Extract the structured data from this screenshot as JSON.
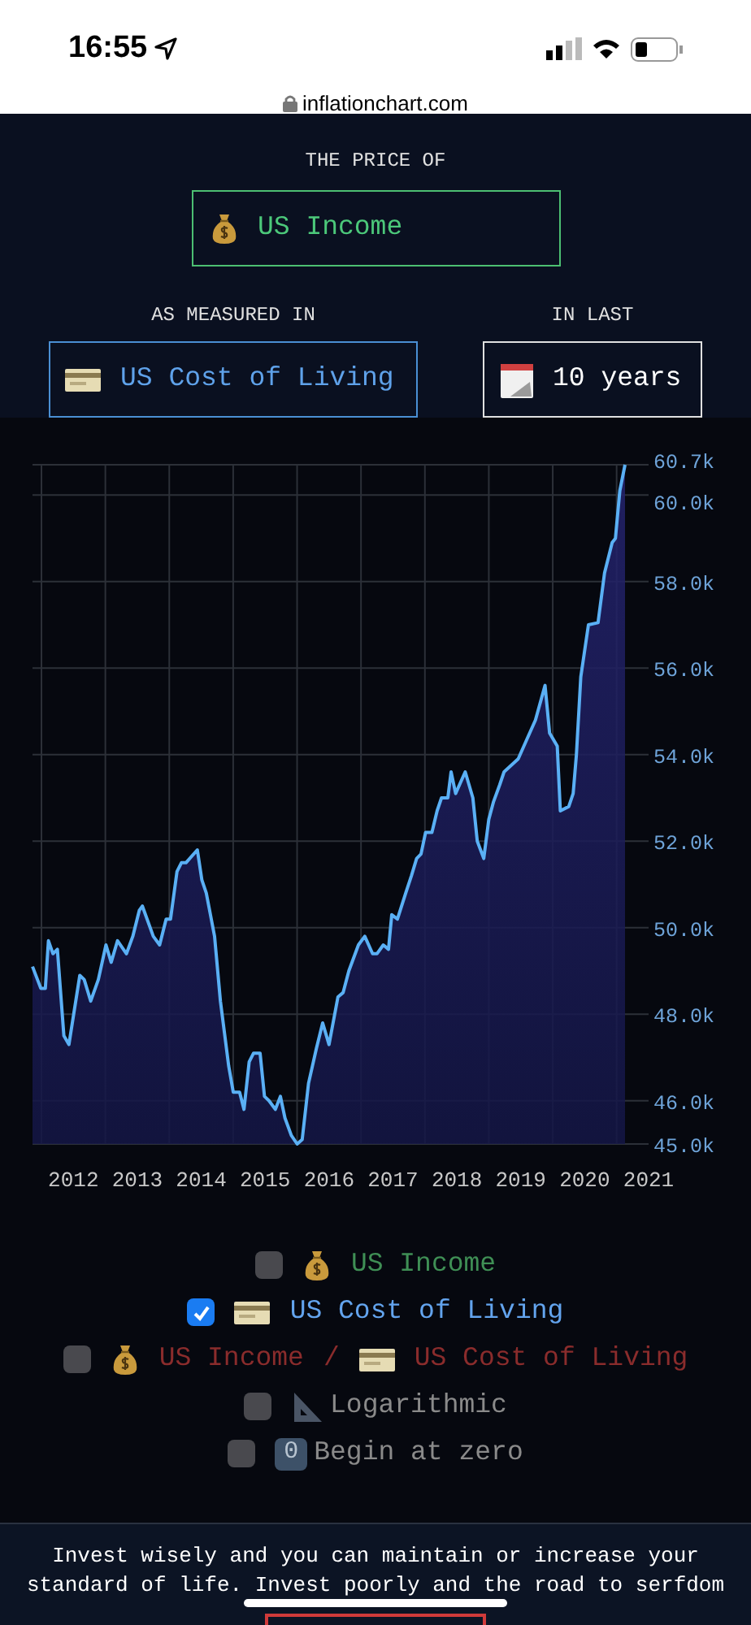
{
  "status_bar": {
    "time": "16:55",
    "url": "inflationchart.com"
  },
  "price_of": {
    "label": "THE PRICE OF",
    "value": "US Income"
  },
  "measured_in": {
    "label": "AS MEASURED IN",
    "value": "US Cost of Living"
  },
  "period": {
    "label": "IN LAST",
    "value": "10 years"
  },
  "chart_data": {
    "type": "area",
    "grid": true,
    "ylim": [
      45.0,
      60.7
    ],
    "xlim": [
      2011.36,
      2021.0
    ],
    "xticks": [
      2012,
      2013,
      2014,
      2015,
      2016,
      2017,
      2018,
      2019,
      2020,
      2021
    ],
    "yticks": [
      {
        "value": 45.0,
        "label": "45.0k"
      },
      {
        "value": 46.0,
        "label": "46.0k"
      },
      {
        "value": 48.0,
        "label": "48.0k"
      },
      {
        "value": 50.0,
        "label": "50.0k"
      },
      {
        "value": 52.0,
        "label": "52.0k"
      },
      {
        "value": 54.0,
        "label": "54.0k"
      },
      {
        "value": 56.0,
        "label": "56.0k"
      },
      {
        "value": 58.0,
        "label": "58.0k"
      },
      {
        "value": 60.0,
        "label": "60.0k"
      },
      {
        "value": 60.7,
        "label": "60.7k"
      }
    ],
    "x": [
      2011.36,
      2011.49,
      2011.56,
      2011.61,
      2011.68,
      2011.75,
      2011.85,
      2011.93,
      2012.1,
      2012.17,
      2012.27,
      2012.39,
      2012.51,
      2012.59,
      2012.69,
      2012.83,
      2012.93,
      2013.03,
      2013.08,
      2013.25,
      2013.35,
      2013.45,
      2013.52,
      2013.62,
      2013.69,
      2013.76,
      2013.94,
      2014.01,
      2014.08,
      2014.21,
      2014.3,
      2014.43,
      2014.5,
      2014.6,
      2014.67,
      2014.75,
      2014.82,
      2014.92,
      2014.99,
      2015.06,
      2015.16,
      2015.24,
      2015.31,
      2015.41,
      2015.5,
      2015.58,
      2015.68,
      2015.8,
      2015.9,
      2016.0,
      2016.14,
      2016.22,
      2016.31,
      2016.46,
      2016.56,
      2016.68,
      2016.75,
      2016.85,
      2016.93,
      2016.98,
      2017.07,
      2017.2,
      2017.29,
      2017.37,
      2017.44,
      2017.51,
      2017.61,
      2017.69,
      2017.76,
      2017.86,
      2017.91,
      2017.98,
      2018.13,
      2018.25,
      2018.32,
      2018.42,
      2018.5,
      2018.57,
      2018.67,
      2018.74,
      2018.96,
      2019.08,
      2019.23,
      2019.38,
      2019.45,
      2019.57,
      2019.62,
      2019.75,
      2019.82,
      2019.87,
      2019.94,
      2020.06,
      2020.21,
      2020.31,
      2020.43,
      2020.48,
      2020.55,
      2020.63
    ],
    "series": [
      {
        "color": "#5ab0f5",
        "values": [
          49.1,
          48.6,
          48.6,
          49.7,
          49.4,
          49.5,
          47.5,
          47.3,
          48.9,
          48.8,
          48.3,
          48.8,
          49.6,
          49.2,
          49.7,
          49.4,
          49.8,
          50.4,
          50.5,
          49.8,
          49.6,
          50.2,
          50.2,
          51.3,
          51.5,
          51.5,
          51.8,
          51.1,
          50.8,
          49.8,
          48.3,
          46.8,
          46.2,
          46.2,
          45.8,
          46.9,
          47.1,
          47.1,
          46.1,
          46.0,
          45.8,
          46.1,
          45.6,
          45.2,
          45.0,
          45.1,
          46.4,
          47.2,
          47.8,
          47.3,
          48.4,
          48.5,
          49.0,
          49.6,
          49.8,
          49.4,
          49.4,
          49.6,
          49.5,
          50.3,
          50.2,
          50.8,
          51.2,
          51.6,
          51.7,
          52.2,
          52.2,
          52.7,
          53.0,
          53.0,
          53.6,
          53.1,
          53.6,
          53.0,
          52.0,
          51.6,
          52.5,
          52.9,
          53.3,
          53.6,
          53.9,
          54.3,
          54.8,
          55.6,
          54.5,
          54.2,
          52.7,
          52.8,
          53.1,
          54.0,
          55.8,
          57.0,
          57.05,
          58.2,
          58.9,
          59.0,
          60.1,
          60.7
        ]
      }
    ]
  },
  "toggles": [
    {
      "kind": "income",
      "label": "US Income",
      "checked": false,
      "color": "#3f8f55"
    },
    {
      "kind": "cost",
      "label": "US Cost of Living",
      "checked": true,
      "color": "#63a4ee"
    },
    {
      "kind": "ratio",
      "label": "US Income",
      "label_2": "US Cost of Living",
      "separator": "/",
      "checked": false,
      "color": "#8a2c2c"
    },
    {
      "kind": "log",
      "label": "Logarithmic",
      "checked": false,
      "color": "#8a8a8a"
    },
    {
      "kind": "zero",
      "label": "Begin at zero",
      "key": "0",
      "checked": false,
      "color": "#8a8a8a"
    }
  ],
  "footer": {
    "text": "Invest wisely and you can maintain or increase your standard of life. Invest poorly and the road to serfdom"
  }
}
